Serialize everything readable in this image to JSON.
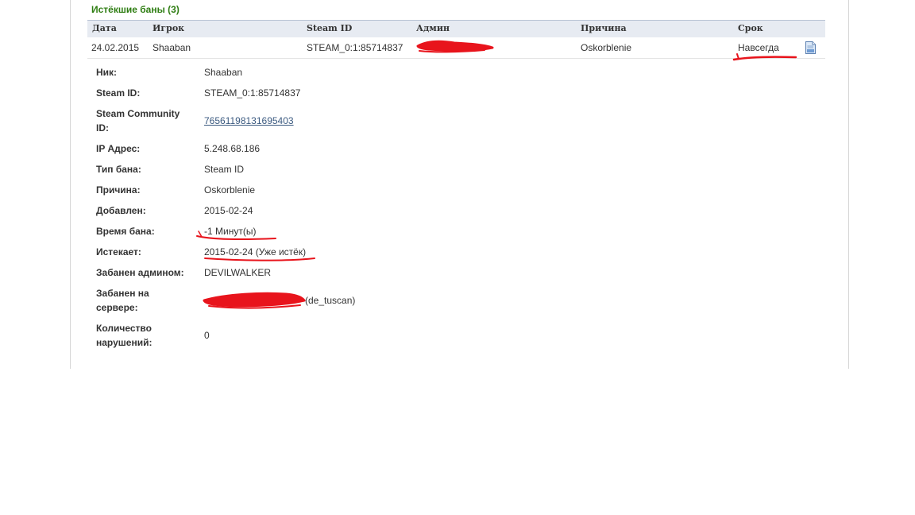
{
  "section": {
    "title": "Истёкшие баны (3)"
  },
  "table": {
    "headers": {
      "date": "Дата",
      "player": "Игрок",
      "steam_id": "Steam ID",
      "admin": "Админ",
      "reason": "Причина",
      "length": "Срок"
    },
    "row": {
      "date": "24.02.2015",
      "player": "Shaaban",
      "steam_id": "STEAM_0:1:85714837",
      "reason": "Oskorblenie",
      "length": "Навсегда",
      "icon": "document-icon"
    }
  },
  "details": {
    "nick_label": "Ник:",
    "nick": "Shaaban",
    "steamid_label": "Steam ID:",
    "steamid": "STEAM_0:1:85714837",
    "community_label": "Steam Community ID:",
    "community": "76561198131695403",
    "ip_label": "IP Адрес:",
    "ip": "5.248.68.186",
    "type_label": "Тип бана:",
    "type": "Steam ID",
    "reason_label": "Причина:",
    "reason": "Oskorblenie",
    "added_label": "Добавлен:",
    "added": "2015-02-24",
    "duration_label": "Время бана:",
    "duration": "-1 Минут(ы)",
    "expires_label": "Истекает:",
    "expires": "2015-02-24 (Уже истёк)",
    "admin_label": "Забанен админом:",
    "admin": "DEVILWALKER",
    "server_label": "Забанен на сервере:",
    "server": "(de_tuscan)",
    "violations_label": "Количество нарушений:",
    "violations": "0"
  },
  "colors": {
    "title_green": "#2e7d12",
    "header_bg": "#e7ebf2",
    "link": "#3b5a80",
    "annotation_red": "#e8141c"
  }
}
